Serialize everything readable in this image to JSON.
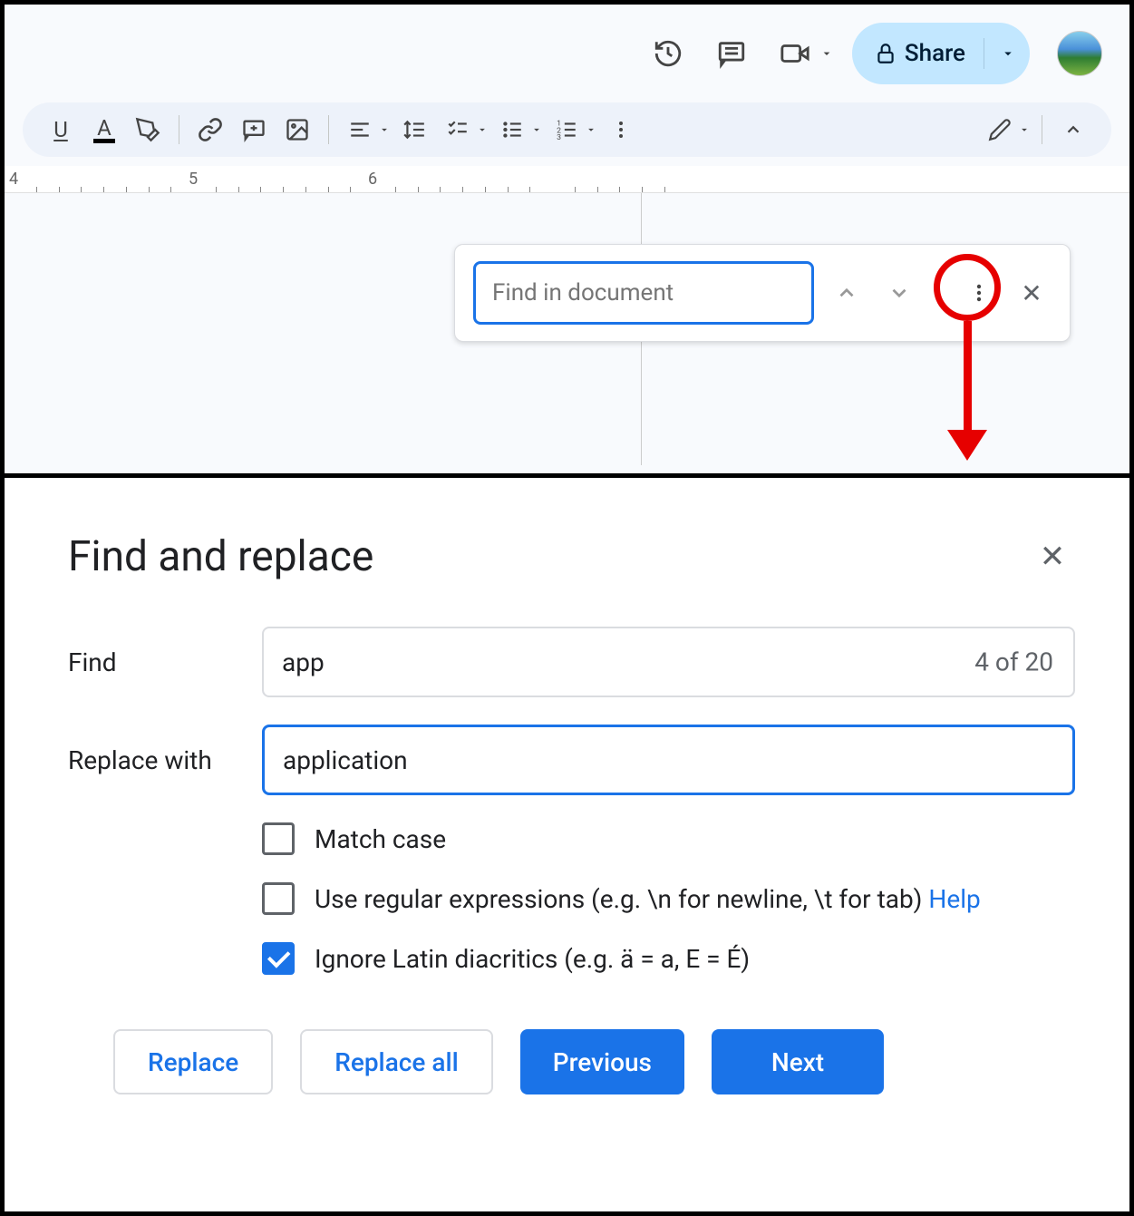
{
  "header": {
    "share_label": "Share"
  },
  "ruler": {
    "marks": [
      "4",
      "5",
      "6"
    ]
  },
  "find_bar": {
    "placeholder": "Find in document"
  },
  "dialog": {
    "title": "Find and replace",
    "find_label": "Find",
    "find_value": "app",
    "result_count": "4 of 20",
    "replace_label": "Replace with",
    "replace_value": "application",
    "match_case_label": "Match case",
    "regex_label": "Use regular expressions (e.g. \\n for newline, \\t for tab) ",
    "help_label": "Help",
    "ignore_diacritics_label": "Ignore Latin diacritics (e.g. ä = a, E = É)",
    "match_case_checked": false,
    "regex_checked": false,
    "ignore_diacritics_checked": true
  },
  "buttons": {
    "replace": "Replace",
    "replace_all": "Replace all",
    "previous": "Previous",
    "next": "Next"
  }
}
